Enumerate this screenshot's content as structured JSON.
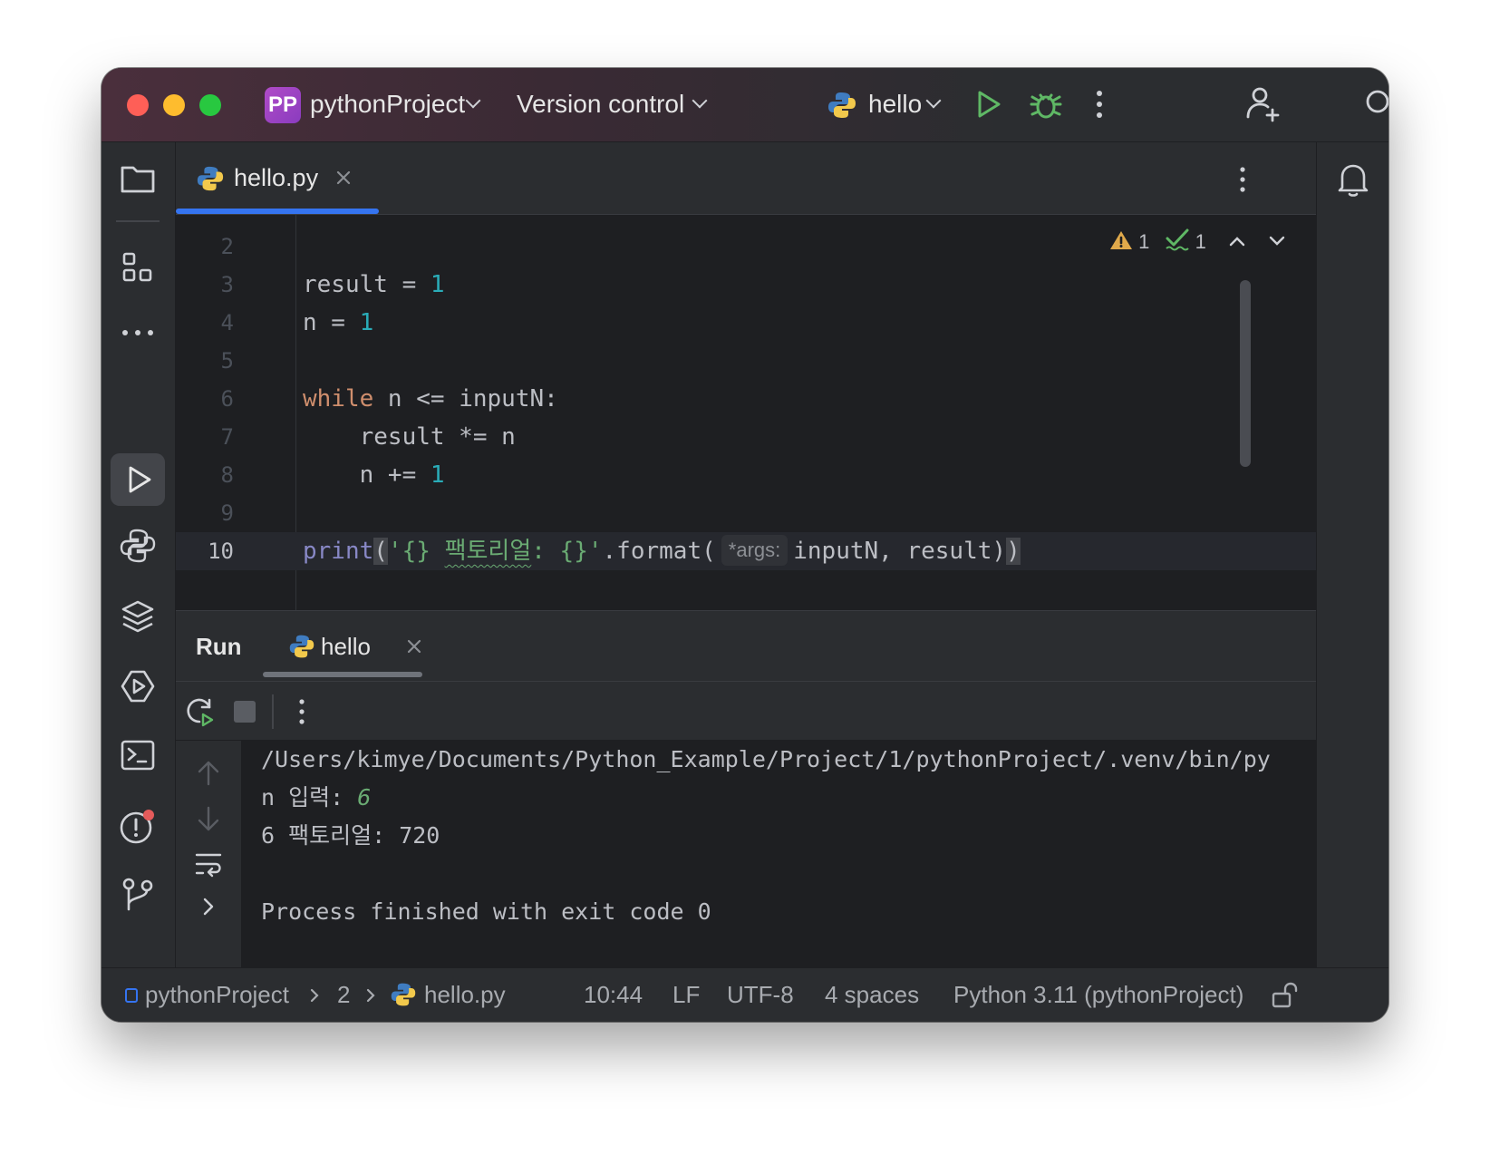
{
  "titlebar": {
    "project_badge": "PP",
    "project_name": "pythonProject",
    "vcs_label": "Version control",
    "run_config": "hello"
  },
  "editor": {
    "tab_label": "hello.py",
    "inspections": {
      "warnings": "1",
      "weak_warnings": "1"
    },
    "lines": [
      {
        "num": "2"
      },
      {
        "num": "3",
        "a": "result = ",
        "b": "1"
      },
      {
        "num": "4",
        "a": "n = ",
        "b": "1"
      },
      {
        "num": "5"
      },
      {
        "num": "6",
        "kw": "while",
        "rest": " n <= inputN:"
      },
      {
        "num": "7",
        "a": "    result *= n"
      },
      {
        "num": "8",
        "a": "    n += ",
        "b": "1"
      },
      {
        "num": "9"
      },
      {
        "num": "10",
        "fn": "print",
        "p1": "(",
        "s1": "'{} ",
        "s2": "팩토리얼",
        "s3": ": {}'",
        "m": ".format(",
        "hint": "*args:",
        "args": "inputN, result)",
        "close": ")"
      }
    ]
  },
  "run_panel": {
    "title": "Run",
    "tab_label": "hello",
    "output": {
      "path": "/Users/kimye/Documents/Python_Example/Project/1/pythonProject/.venv/bin/py",
      "prompt": "n 입력: ",
      "input_value": "6",
      "result": "6 팩토리얼: 720",
      "exit": "Process finished with exit code 0"
    }
  },
  "statusbar": {
    "crumb_project": "pythonProject",
    "crumb_folder": "2",
    "crumb_file": "hello.py",
    "position": "10:44",
    "line_sep": "LF",
    "encoding": "UTF-8",
    "indent": "4 spaces",
    "interpreter": "Python 3.11 (pythonProject)"
  },
  "colors": {
    "accent": "#3574f0",
    "keyword": "#cf8e6d",
    "number": "#2aacb8",
    "string": "#6aab73",
    "run_green": "#5fb865"
  }
}
